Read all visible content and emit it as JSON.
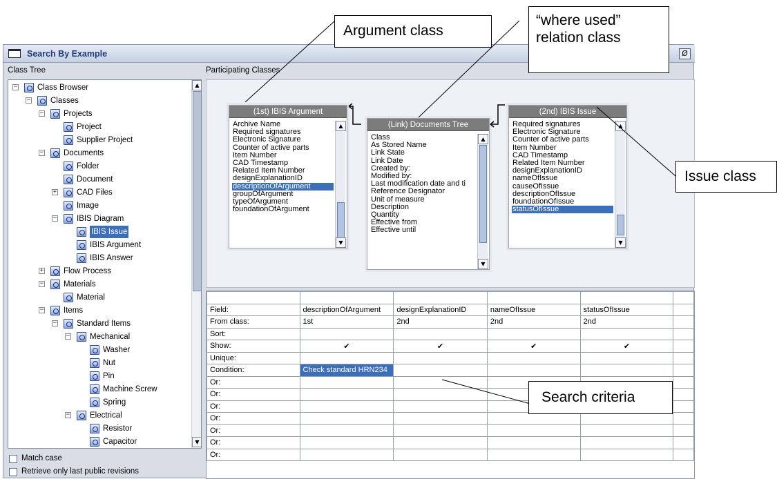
{
  "window": {
    "title": "Search By Example",
    "control_glyph": "Ø"
  },
  "left": {
    "label": "Class Tree",
    "tree": [
      {
        "t": "Class Browser",
        "lvl": 0,
        "tg": "minus",
        "icon": "class-browser"
      },
      {
        "t": "Classes",
        "lvl": 1,
        "tg": "minus"
      },
      {
        "t": "Projects",
        "lvl": 2,
        "tg": "minus"
      },
      {
        "t": "Project",
        "lvl": 3
      },
      {
        "t": "Supplier Project",
        "lvl": 3
      },
      {
        "t": "Documents",
        "lvl": 2,
        "tg": "minus"
      },
      {
        "t": "Folder",
        "lvl": 3
      },
      {
        "t": "Document",
        "lvl": 3
      },
      {
        "t": "CAD Files",
        "lvl": 3,
        "tg": "plus"
      },
      {
        "t": "Image",
        "lvl": 3
      },
      {
        "t": "IBIS Diagram",
        "lvl": 3,
        "tg": "minus"
      },
      {
        "t": "IBIS Issue",
        "lvl": 4,
        "sel": true
      },
      {
        "t": "IBIS Argument",
        "lvl": 4
      },
      {
        "t": "IBIS Answer",
        "lvl": 4
      },
      {
        "t": "Flow Process",
        "lvl": 2,
        "tg": "plus"
      },
      {
        "t": "Materials",
        "lvl": 2,
        "tg": "minus"
      },
      {
        "t": "Material",
        "lvl": 3
      },
      {
        "t": "Items",
        "lvl": 2,
        "tg": "minus"
      },
      {
        "t": "Standard Items",
        "lvl": 3,
        "tg": "minus"
      },
      {
        "t": "Mechanical",
        "lvl": 4,
        "tg": "minus"
      },
      {
        "t": "Washer",
        "lvl": 5
      },
      {
        "t": "Nut",
        "lvl": 5
      },
      {
        "t": "Pin",
        "lvl": 5
      },
      {
        "t": "Machine Screw",
        "lvl": 5
      },
      {
        "t": "Spring",
        "lvl": 5
      },
      {
        "t": "Electrical",
        "lvl": 4,
        "tg": "minus"
      },
      {
        "t": "Resistor",
        "lvl": 5
      },
      {
        "t": "Capacitor",
        "lvl": 5
      }
    ],
    "match_case": "Match case",
    "retrieve_only": "Retrieve only last public revisions"
  },
  "right": {
    "label": "Participating Classes",
    "classes": [
      {
        "header": "(1st) IBIS Argument",
        "items": [
          "Archive Name",
          "Required signatures",
          "Electronic Signature",
          "Counter of active parts",
          "Item Number",
          "CAD Timestamp",
          "Related Item Number",
          "designExplanationID",
          "descriptionOfArgument",
          "groupOfArgument",
          "typeOfArgument",
          "foundationOfArgument"
        ],
        "selected": "descriptionOfArgument"
      },
      {
        "header": "(Link) Documents Tree",
        "items": [
          "Class",
          "As Stored Name",
          "Link State",
          "Link Date",
          "Created by:",
          "Modified by:",
          "Last modification date and ti",
          "Reference Designator",
          "Unit of measure",
          "Description",
          "Quantity",
          "Effective from",
          "Effective until"
        ]
      },
      {
        "header": "(2nd) IBIS Issue",
        "items": [
          "Required signatures",
          "Electronic Signature",
          "Counter of active parts",
          "Item Number",
          "CAD Timestamp",
          "Related Item Number",
          "designExplanationID",
          "nameOfIssue",
          "causeOfIssue",
          "descriptionOfIssue",
          "foundationOfIssue",
          "statusOfIssue"
        ],
        "selected": "statusOfIssue"
      }
    ],
    "grid": {
      "row_labels": [
        "Field:",
        "From class:",
        "Sort:",
        "Show:",
        "Unique:",
        "Condition:",
        "Or:",
        "Or:",
        "Or:",
        "Or:",
        "Or:",
        "Or:",
        "Or:"
      ],
      "columns": [
        {
          "field": "descriptionOfArgument",
          "from": "1st",
          "show": "✔",
          "condition": "Check standard HRN234"
        },
        {
          "field": "designExplanationID",
          "from": "2nd",
          "show": "✔",
          "condition": ""
        },
        {
          "field": "nameOfIssue",
          "from": "2nd",
          "show": "✔",
          "condition": ""
        },
        {
          "field": "statusOfIssue",
          "from": "2nd",
          "show": "✔",
          "condition": ""
        }
      ]
    }
  },
  "annotations": {
    "argument_class": "Argument class",
    "where_used_1": "“where used”",
    "where_used_2": "relation class",
    "issue_class": "Issue class",
    "search_criteria": "Search criteria"
  }
}
